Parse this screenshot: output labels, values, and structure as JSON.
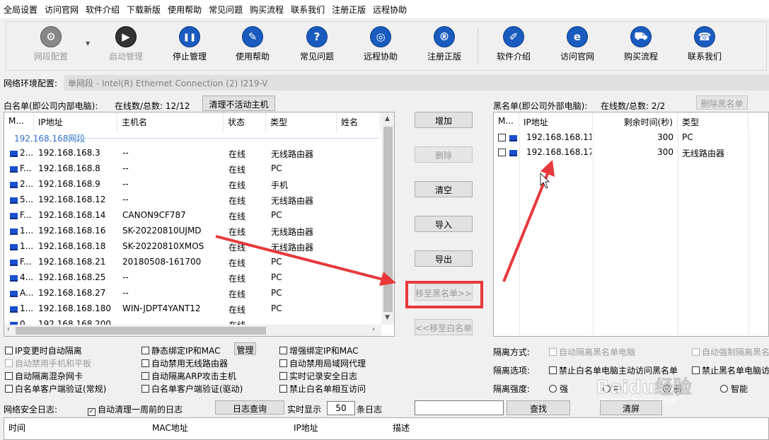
{
  "menu": [
    "全局设置",
    "访问官网",
    "软件介绍",
    "下载新版",
    "使用帮助",
    "常见问题",
    "购买流程",
    "联系我们",
    "注册正版",
    "远程协助"
  ],
  "toolbar": [
    {
      "label": "网段配置",
      "icon": "gear-icon",
      "glyph": "⚙",
      "disabled": true
    },
    {
      "label": "启动管理",
      "icon": "play-icon",
      "glyph": "▶",
      "disabled": true
    },
    {
      "label": "停止管理",
      "icon": "pause-icon",
      "glyph": "❚❚",
      "disabled": false
    },
    {
      "label": "使用帮助",
      "icon": "graduation-cap-icon",
      "glyph": "✎",
      "disabled": false
    },
    {
      "label": "常见问题",
      "icon": "question-icon",
      "glyph": "?",
      "disabled": false
    },
    {
      "label": "远程协助",
      "icon": "globe-icon",
      "glyph": "◎",
      "disabled": false
    },
    {
      "label": "注册正版",
      "icon": "registered-icon",
      "glyph": "®",
      "disabled": false
    },
    {
      "label": "软件介绍",
      "icon": "document-icon",
      "glyph": "✐",
      "disabled": false
    },
    {
      "label": "访问官网",
      "icon": "browser-icon",
      "glyph": "e",
      "disabled": false
    },
    {
      "label": "购买流程",
      "icon": "cart-icon",
      "glyph": "⛟",
      "disabled": false
    },
    {
      "label": "联系我们",
      "icon": "phone-icon",
      "glyph": "☎",
      "disabled": false
    }
  ],
  "network": {
    "label": "网络环境配置:",
    "value": "单网段 - Intel(R) Ethernet Connection (2) I219-V"
  },
  "whitelist": {
    "title": "白名单(即公司内部电脑):",
    "online_label": "在线数/总数: 12/12",
    "clear_btn": "清理不活动主机",
    "columns": [
      "M...",
      "IP地址",
      "主机名",
      "状态",
      "类型",
      "姓名"
    ],
    "group": "192.168.168网段",
    "rows": [
      [
        "2...",
        "192.168.168.3",
        "--",
        "在线",
        "无线路由器"
      ],
      [
        "F...",
        "192.168.168.8",
        "--",
        "在线",
        "PC"
      ],
      [
        "2...",
        "192.168.168.9",
        "--",
        "在线",
        "手机"
      ],
      [
        "5...",
        "192.168.168.12",
        "--",
        "在线",
        "无线路由器"
      ],
      [
        "F...",
        "192.168.168.14",
        "CANON9CF787",
        "在线",
        "PC"
      ],
      [
        "1...",
        "192.168.168.16",
        "SK-20220810UJMD",
        "在线",
        "无线路由器"
      ],
      [
        "1...",
        "192.168.168.18",
        "SK-20220810XMOS",
        "在线",
        "无线路由器"
      ],
      [
        "F...",
        "192.168.168.21",
        "20180508-161700",
        "在线",
        "PC"
      ],
      [
        "4...",
        "192.168.168.25",
        "--",
        "在线",
        "PC"
      ],
      [
        "A...",
        "192.168.168.27",
        "--",
        "在线",
        "PC"
      ],
      [
        "1...",
        "192.168.168.180",
        "WIN-JDPT4YANT12",
        "在线",
        "PC"
      ],
      [
        "0...",
        "192.168.168.200",
        "",
        "在线",
        ""
      ]
    ]
  },
  "mid_buttons": [
    {
      "label": "增加",
      "disabled": false
    },
    {
      "label": "删除",
      "disabled": true
    },
    {
      "label": "清空",
      "disabled": false
    },
    {
      "label": "导入",
      "disabled": false
    },
    {
      "label": "导出",
      "disabled": false
    },
    {
      "label": "移至黑名单>>",
      "disabled": true
    },
    {
      "label": "<<移至白名单",
      "disabled": true
    }
  ],
  "blacklist": {
    "title": "黑名单(即公司外部电脑):",
    "online_label": "在线数/总数: 2/2",
    "delete_btn": "删除黑名单",
    "columns": [
      "M...",
      "IP地址",
      "剩余时间(秒)",
      "类型"
    ],
    "rows": [
      [
        "192.168.168.11",
        "300",
        "PC"
      ],
      [
        "192.168.168.17",
        "300",
        "无线路由器"
      ]
    ]
  },
  "options_left": [
    [
      {
        "text": "IP变更时自动隔离",
        "disabled": false
      },
      {
        "text": "静态绑定IP和MAC",
        "disabled": false
      },
      {
        "text": "增强绑定IP和MAC",
        "disabled": false
      }
    ],
    [
      {
        "text": "自动禁用手机和平板",
        "disabled": true
      },
      {
        "text": "自动禁用无线路由器",
        "disabled": false
      },
      {
        "text": "自动禁用局域网代理",
        "disabled": false
      }
    ],
    [
      {
        "text": "自动隔离混杂网卡",
        "disabled": false
      },
      {
        "text": "自动隔离ARP攻击主机",
        "disabled": false
      },
      {
        "text": "实时记录安全日志",
        "disabled": false
      }
    ],
    [
      {
        "text": "白名单客户端验证(常规)",
        "disabled": false
      },
      {
        "text": "白名单客户端验证(驱动)",
        "disabled": false
      },
      {
        "text": "禁止白名单相互访问",
        "disabled": false
      }
    ]
  ],
  "manage_btn": "管理",
  "isolation": {
    "mode_label": "隔离方式:",
    "mode_opts": [
      "自动隔离黑名单电脑",
      "自动强制隔离黑名"
    ],
    "option_label": "隔离选项:",
    "option_opts": [
      "禁止白名单电脑主动访问黑名单",
      "禁止黑名单电脑访"
    ],
    "strength_label": "隔离强度:",
    "strength_opts": [
      "强",
      "中",
      "弱",
      "智能"
    ]
  },
  "log": {
    "label": "网络安全日志:",
    "auto_clean": "自动清理一周前的日志",
    "query_btn": "日志查询",
    "realtime_label": "实时显示",
    "count": "50",
    "unit": "条日志",
    "search_value": "",
    "search_btn": "查找",
    "clear_btn": "清屏",
    "columns": [
      "时间",
      "MAC地址",
      "IP地址",
      "描述"
    ]
  },
  "watermark": {
    "text": "Baidu经验",
    "url": "jingyan.baidu.com"
  },
  "colors": {
    "highlight": "#e8383b",
    "group_text": "#2c6fc9",
    "pc_icon": "#1a4fd0"
  }
}
